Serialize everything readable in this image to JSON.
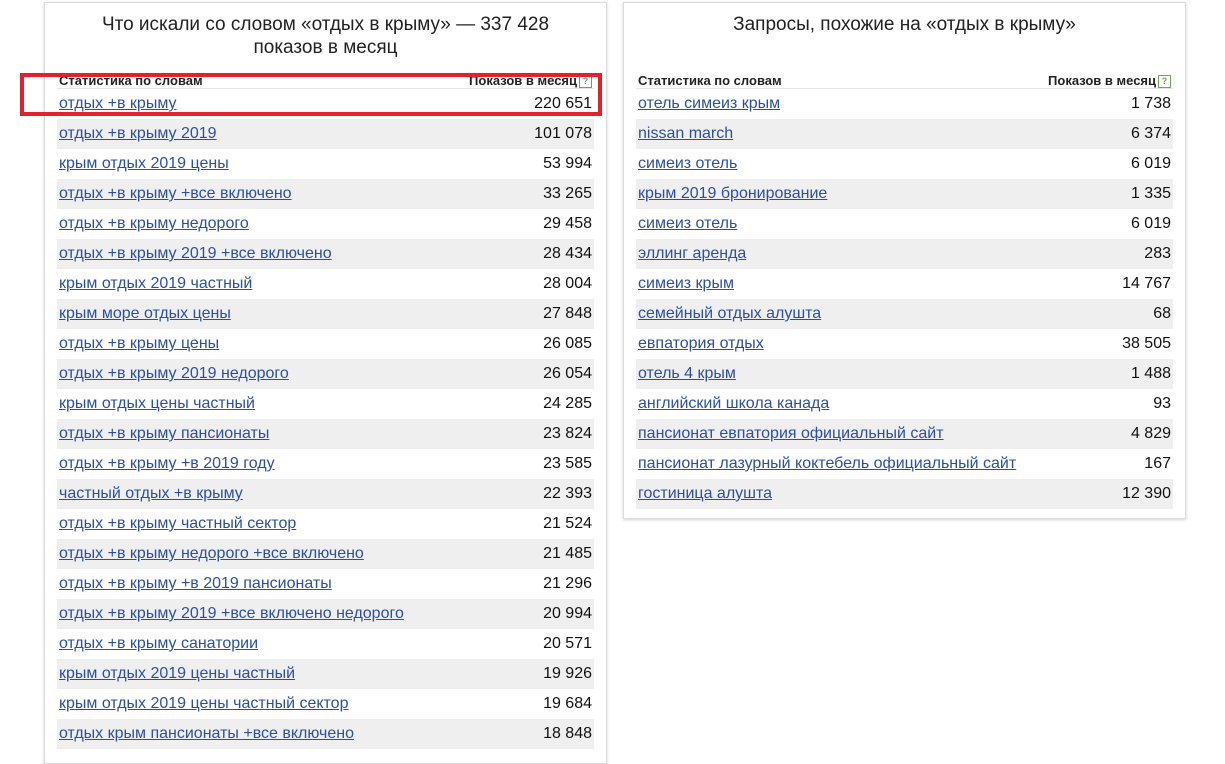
{
  "left_panel": {
    "title": "Что искали со словом «отдых в крыму» — 337 428 показов в месяц",
    "col_words": "Статистика по словам",
    "col_count": "Показов в месяц",
    "rows": [
      {
        "phrase": "отдых +в крыму",
        "count": "220 651"
      },
      {
        "phrase": "отдых +в крыму 2019",
        "count": "101 078"
      },
      {
        "phrase": "крым отдых 2019 цены",
        "count": "53 994"
      },
      {
        "phrase": "отдых +в крыму +все включено",
        "count": "33 265"
      },
      {
        "phrase": "отдых +в крыму недорого",
        "count": "29 458"
      },
      {
        "phrase": "отдых +в крыму 2019 +все включено",
        "count": "28 434"
      },
      {
        "phrase": "крым отдых 2019 частный",
        "count": "28 004"
      },
      {
        "phrase": "крым море отдых цены",
        "count": "27 848"
      },
      {
        "phrase": "отдых +в крыму цены",
        "count": "26 085"
      },
      {
        "phrase": "отдых +в крыму 2019 недорого",
        "count": "26 054"
      },
      {
        "phrase": "крым отдых цены частный",
        "count": "24 285"
      },
      {
        "phrase": "отдых +в крыму пансионаты",
        "count": "23 824"
      },
      {
        "phrase": "отдых +в крыму +в 2019 году",
        "count": "23 585"
      },
      {
        "phrase": "частный отдых +в крыму",
        "count": "22 393"
      },
      {
        "phrase": "отдых +в крыму частный сектор",
        "count": "21 524"
      },
      {
        "phrase": "отдых +в крыму недорого +все включено",
        "count": "21 485"
      },
      {
        "phrase": "отдых +в крыму +в 2019 пансионаты",
        "count": "21 296"
      },
      {
        "phrase": "отдых +в крыму 2019 +все включено недорого",
        "count": "20 994"
      },
      {
        "phrase": "отдых +в крыму санатории",
        "count": "20 571"
      },
      {
        "phrase": "крым отдых 2019 цены частный",
        "count": "19 926"
      },
      {
        "phrase": "крым отдых 2019 цены частный сектор",
        "count": "19 684"
      },
      {
        "phrase": "отдых крым пансионаты +все включено",
        "count": "18 848"
      }
    ]
  },
  "right_panel": {
    "title": "Запросы, похожие на «отдых в крыму»",
    "col_words": "Статистика по словам",
    "col_count": "Показов в месяц",
    "rows": [
      {
        "phrase": "отель симеиз крым",
        "count": "1 738"
      },
      {
        "phrase": "nissan march",
        "count": "6 374"
      },
      {
        "phrase": "симеиз отель",
        "count": "6 019"
      },
      {
        "phrase": "крым 2019 бронирование",
        "count": "1 335"
      },
      {
        "phrase": "симеиз отель",
        "count": "6 019"
      },
      {
        "phrase": "эллинг аренда",
        "count": "283"
      },
      {
        "phrase": "симеиз крым",
        "count": "14 767"
      },
      {
        "phrase": "семейный отдых алушта",
        "count": "68"
      },
      {
        "phrase": "евпатория отдых",
        "count": "38 505"
      },
      {
        "phrase": "отель 4 крым",
        "count": "1 488"
      },
      {
        "phrase": "английский школа канада",
        "count": "93"
      },
      {
        "phrase": "пансионат евпатория официальный сайт",
        "count": "4 829"
      },
      {
        "phrase": "пансионат лазурный коктебель официальный сайт",
        "count": "167"
      },
      {
        "phrase": "гостиница алушта",
        "count": "12 390"
      }
    ]
  },
  "hint_icon_glyph": "?",
  "highlight_color": "#e4202a"
}
